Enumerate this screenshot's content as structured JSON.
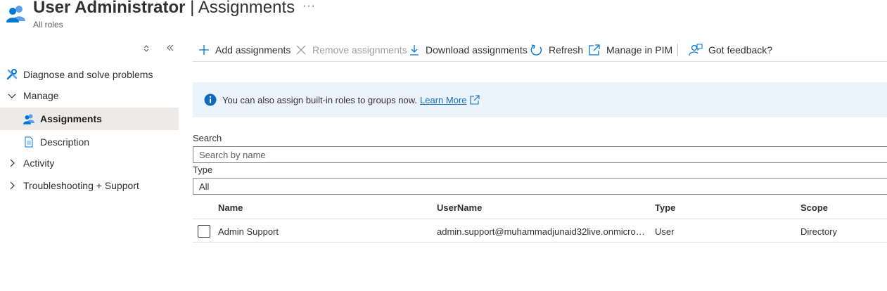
{
  "header": {
    "title_main": "User Administrator",
    "title_sep": " | ",
    "title_sub": "Assignments",
    "more_label": "···",
    "subtitle": "All roles"
  },
  "sidebar": {
    "collapse_up": "◇",
    "collapse_left": "«",
    "items": [
      {
        "label": "Diagnose and solve problems",
        "icon": "wrench-icon"
      },
      {
        "label": "Manage",
        "icon": "chevron-down-icon",
        "expanded": true
      },
      {
        "label": "Assignments",
        "icon": "users-icon",
        "selected": true
      },
      {
        "label": "Description",
        "icon": "document-icon"
      },
      {
        "label": "Activity",
        "icon": "chevron-right-icon"
      },
      {
        "label": "Troubleshooting + Support",
        "icon": "chevron-right-icon"
      }
    ]
  },
  "toolbar": {
    "add": "Add assignments",
    "remove": "Remove assignments",
    "download": "Download assignments",
    "refresh": "Refresh",
    "manage_pim": "Manage in PIM",
    "feedback": "Got feedback?"
  },
  "banner": {
    "text": "You can also assign built-in roles to groups now.",
    "link": "Learn More"
  },
  "filters": {
    "search_label": "Search",
    "search_placeholder": "Search by name",
    "search_value": "",
    "type_label": "Type",
    "type_value": "All"
  },
  "table": {
    "columns": [
      "Name",
      "UserName",
      "Type",
      "Scope"
    ],
    "rows": [
      {
        "name": "Admin Support",
        "username": "admin.support@muhammadjunaid32live.onmicros…",
        "type": "User",
        "scope": "Directory",
        "checked": false
      }
    ]
  },
  "colors": {
    "accent": "#0f6cbd",
    "banner_bg": "#ebf3fc",
    "selected_bg": "#edebe9"
  }
}
